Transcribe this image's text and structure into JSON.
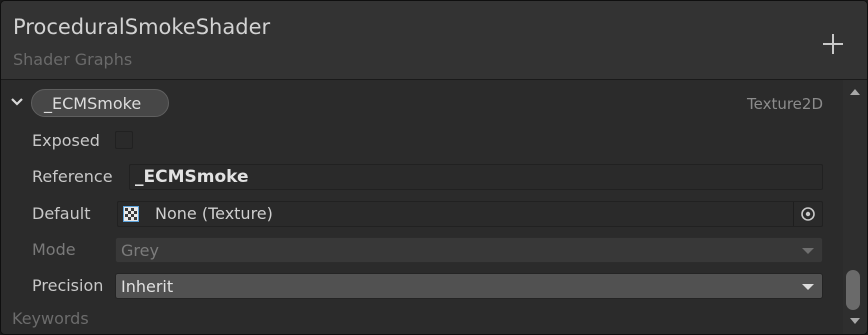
{
  "header": {
    "title": "ProceduralSmokeShader",
    "subtitle": "Shader Graphs",
    "add_icon": "plus-icon"
  },
  "property": {
    "name": "_ECMSmoke",
    "type": "Texture2D",
    "expanded": true,
    "fields": {
      "exposed_label": "Exposed",
      "exposed_checked": false,
      "reference_label": "Reference",
      "reference_value": "_ECMSmoke",
      "default_label": "Default",
      "default_value": "None (Texture)",
      "mode_label": "Mode",
      "mode_value": "Grey",
      "precision_label": "Precision",
      "precision_value": "Inherit"
    }
  },
  "keywords_label": "Keywords",
  "colors": {
    "panel_bg": "#2b2b2b",
    "header_bg": "#333333",
    "field_bg": "#2a2a2a",
    "dropdown_active": "#515151"
  }
}
